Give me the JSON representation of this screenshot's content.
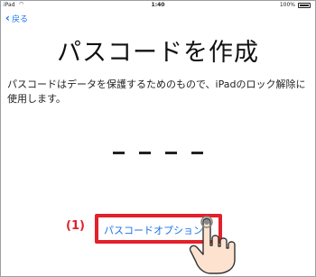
{
  "status_bar": {
    "carrier": "iPad",
    "wifi_icon": "wifi-icon",
    "time": "1:40",
    "battery_percent": "100%"
  },
  "nav": {
    "back_label": "戻る"
  },
  "main": {
    "title": "パスコードを作成",
    "description": "パスコードはデータを保護するためのもので、iPadのロック解除に使用します。",
    "passcode_length": 4
  },
  "options": {
    "button_label": "パスコードオプション",
    "step_label": "(1)"
  },
  "colors": {
    "accent": "#1a73e8",
    "highlight": "#e2212b"
  }
}
